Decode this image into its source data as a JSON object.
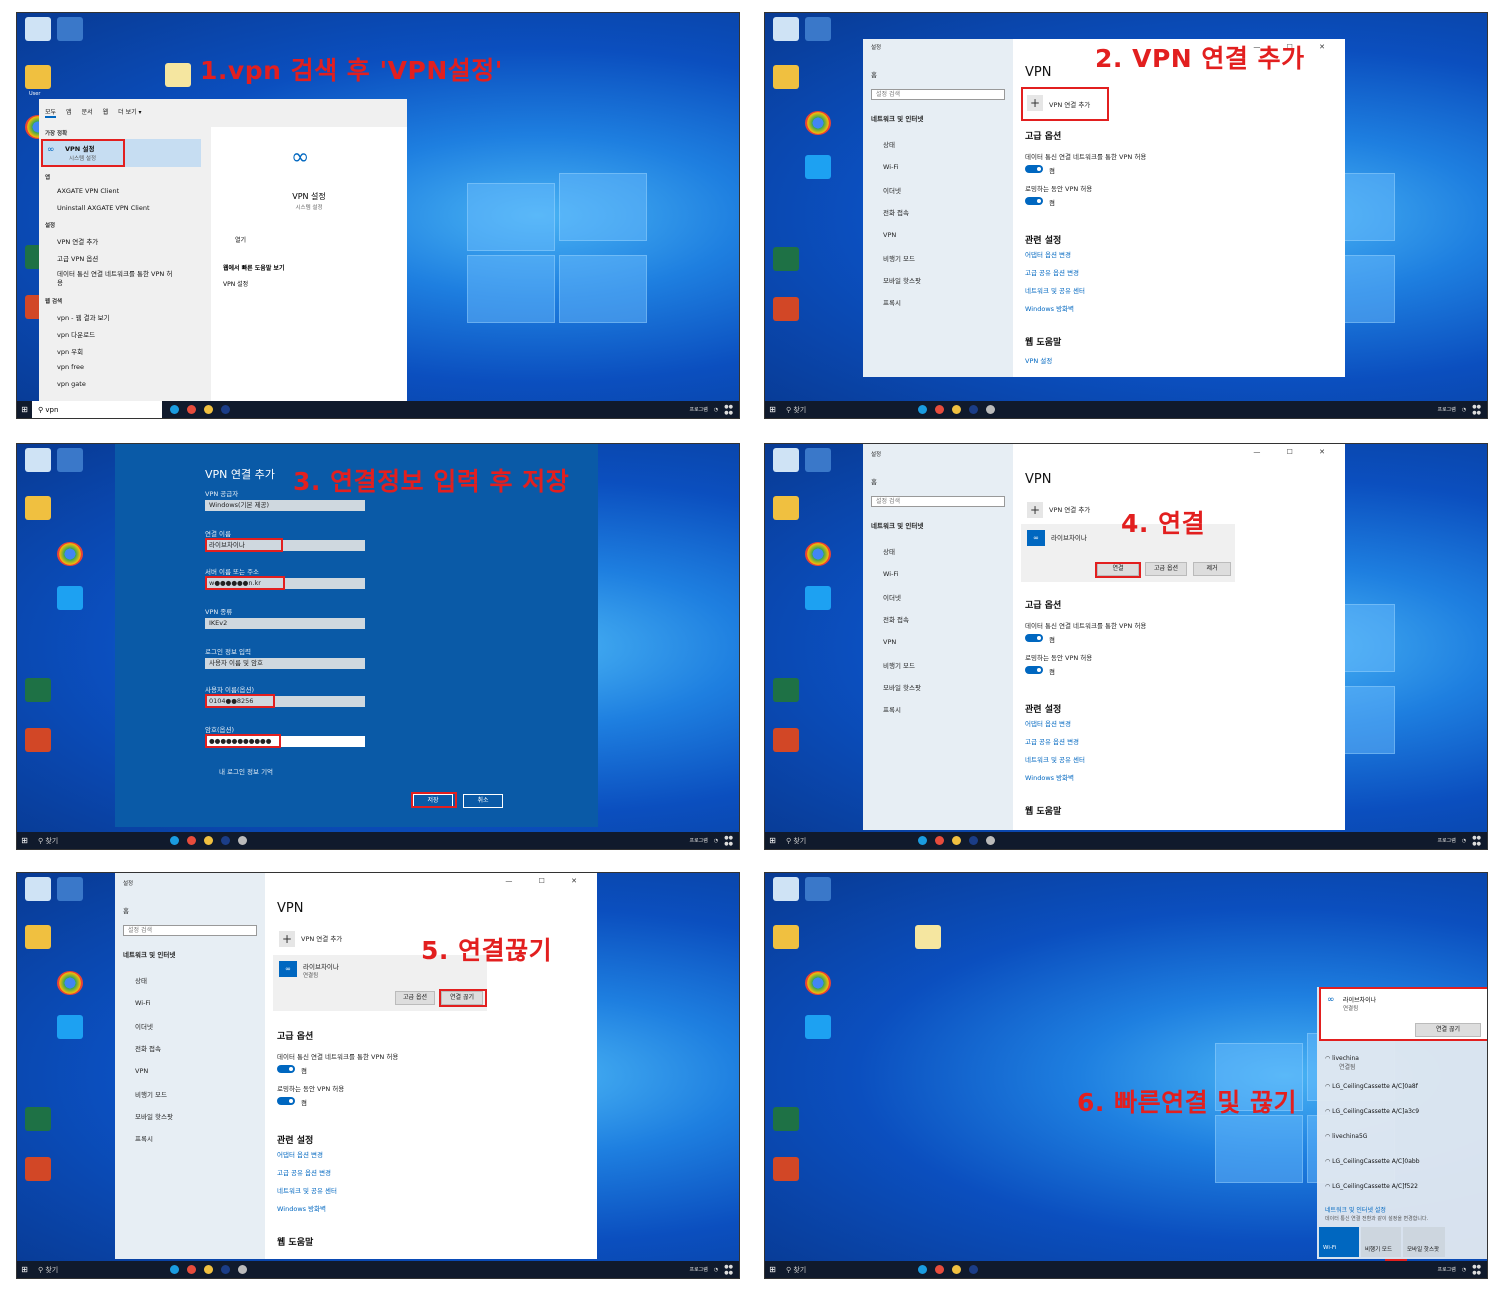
{
  "colors": {
    "accent": "#0067c0",
    "highlight": "#e21f1f",
    "taskbar": "#101a2c",
    "desktop": "#0b4fbf"
  },
  "taskbar": {
    "search_placeholder": "찾기",
    "search_value": "vpn",
    "program_label": "프로그램",
    "start_icon": "windows-icon"
  },
  "desktop": {
    "icon_labels": [
      "User",
      "Chrome",
      "Internet Explorer",
      "PowerPoint"
    ]
  },
  "steps": [
    "1.vpn 검색 후 'VPN설정'",
    "2. VPN 연결 추가",
    "3. 연결정보 입력 후 저장",
    "4. 연결",
    "5. 연결끊기",
    "6. 빠른연결 및 끊기"
  ],
  "start_search": {
    "tabs": [
      "모두",
      "앱",
      "문서",
      "웹",
      "더 보기 ▾"
    ],
    "best_match_header": "가장 정확",
    "best_match_title": "VPN 설정",
    "best_match_sub": "시스템 설정",
    "apps_header": "앱",
    "apps": [
      "AXGATE VPN Client",
      "Uninstall AXGATE VPN Client"
    ],
    "settings_header": "설정",
    "settings": [
      "VPN 연결 추가",
      "고급 VPN 옵션",
      "데이터 통신 연결 네트워크를 통한 VPN 허용"
    ],
    "web_header": "웹 검색",
    "web": [
      "vpn - 웹 결과 보기",
      "vpn 다운로드",
      "vpn 우회",
      "vpn free",
      "vpn gate"
    ],
    "preview_title": "VPN 설정",
    "preview_sub": "시스템 설정",
    "open": "열기",
    "web_help": "웹에서 빠른 도움말 보기",
    "web_help_item": "VPN 설정"
  },
  "settings_app": {
    "window_title": "설정",
    "home": "홈",
    "search_placeholder": "설정 검색",
    "category": "네트워크 및 인터넷",
    "nav": [
      "상태",
      "Wi-Fi",
      "이더넷",
      "전화 접속",
      "VPN",
      "비행기 모드",
      "모바일 핫스팟",
      "프록시"
    ],
    "title": "VPN",
    "add_vpn": "VPN 연결 추가",
    "advanced": "고급 옵션",
    "metered": "데이터 통신 연결 네트워크를 통한 VPN 허용",
    "roaming": "로밍하는 동안 VPN 허용",
    "on": "켬",
    "related": "관련 설정",
    "related_links": [
      "어댑터 옵션 변경",
      "고급 공유 옵션 변경",
      "네트워크 및 공유 센터",
      "Windows 방화벽"
    ],
    "web_help": "웹 도움말",
    "web_help_link": "VPN 설정",
    "connection_name": "라이브차이나",
    "connected": "연결됨",
    "connect": "연결",
    "advanced_btn": "고급 옵션",
    "remove": "제거",
    "disconnect": "연결 끊기"
  },
  "add_dialog": {
    "title": "VPN 연결 추가",
    "provider_label": "VPN 공급자",
    "provider": "Windows(기본 제공)",
    "name_label": "연결 이름",
    "name": "라이브차이나",
    "server_label": "서버 이름 또는 주소",
    "server": "w●●●●●●n.kr",
    "type_label": "VPN 종류",
    "type": "IKEv2",
    "signin_label": "로그인 정보 입력",
    "signin": "사용자 이름 및 암호",
    "user_label": "사용자 이름(옵션)",
    "user": "0104●●8256",
    "pwd_label": "암호(옵션)",
    "pwd": "●●●●●●●●●●●",
    "remember": "내 로그인 정보 기억",
    "save": "저장",
    "cancel": "취소"
  },
  "flyout": {
    "vpn_name": "라이브차이나",
    "vpn_status": "연결됨",
    "disconnect": "연결 끊기",
    "networks": [
      {
        "name": "livechina",
        "status": "연결됨"
      },
      {
        "name": "LG_CeilingCassette A/C]0a8f",
        "status": ""
      },
      {
        "name": "LG_CeilingCassette A/C]a3c9",
        "status": ""
      },
      {
        "name": "livechina5G",
        "status": ""
      },
      {
        "name": "LG_CeilingCassette A/C]0abb",
        "status": ""
      },
      {
        "name": "LG_CeilingCassette A/C]f522",
        "status": ""
      }
    ],
    "settings_title": "네트워크 및 인터넷 설정",
    "settings_sub": "데이터 통신 연결 전환과 같이 설정을 변경합니다.",
    "tiles": [
      "Wi-Fi",
      "비행기 모드",
      "모바일 핫스팟"
    ]
  }
}
